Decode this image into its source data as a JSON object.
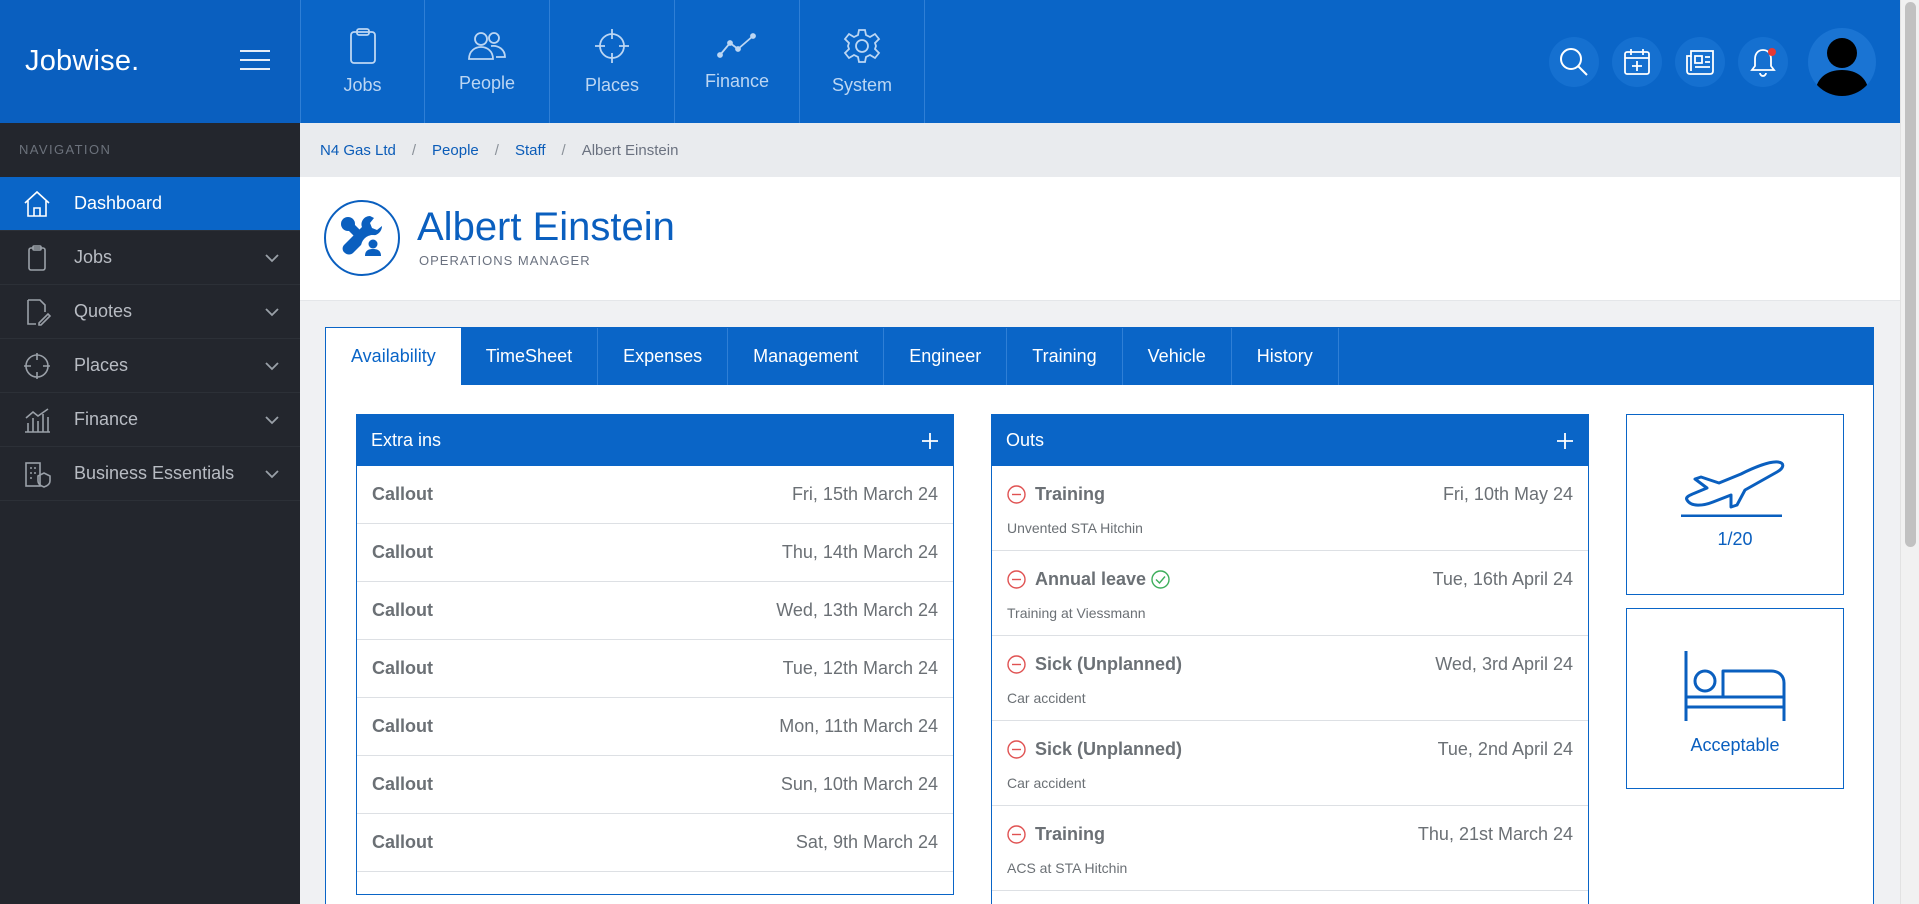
{
  "brand": {
    "name": "Jobwise."
  },
  "sidebar": {
    "heading": "NAVIGATION",
    "items": [
      {
        "label": "Dashboard",
        "icon": "home-icon",
        "active": true
      },
      {
        "label": "Jobs",
        "icon": "clipboard-icon"
      },
      {
        "label": "Quotes",
        "icon": "quote-edit-icon"
      },
      {
        "label": "Places",
        "icon": "crosshair-icon"
      },
      {
        "label": "Finance",
        "icon": "bar-chart-icon"
      },
      {
        "label": "Business Essentials",
        "icon": "building-shield-icon"
      }
    ]
  },
  "topnav": {
    "items": [
      {
        "label": "Jobs",
        "icon": "clipboard-icon"
      },
      {
        "label": "People",
        "icon": "people-icon"
      },
      {
        "label": "Places",
        "icon": "crosshair-icon"
      },
      {
        "label": "Finance",
        "icon": "line-chart-icon"
      },
      {
        "label": "System",
        "icon": "gear-icon"
      }
    ],
    "actions": [
      "search-icon",
      "calendar-plus-icon",
      "newspaper-icon",
      "bell-icon",
      "avatar"
    ]
  },
  "breadcrumb": {
    "items": [
      "N4 Gas Ltd",
      "People",
      "Staff"
    ],
    "current": "Albert Einstein"
  },
  "profile": {
    "name": "Albert Einstein",
    "role": "OPERATIONS MANAGER",
    "icon": "tools-person-icon"
  },
  "tabs": [
    "Availability",
    "TimeSheet",
    "Expenses",
    "Management",
    "Engineer",
    "Training",
    "Vehicle",
    "History"
  ],
  "extra_ins": {
    "title": "Extra ins",
    "rows": [
      {
        "type": "Callout",
        "date": "Fri, 15th March 24"
      },
      {
        "type": "Callout",
        "date": "Thu, 14th March 24"
      },
      {
        "type": "Callout",
        "date": "Wed, 13th March 24"
      },
      {
        "type": "Callout",
        "date": "Tue, 12th March 24"
      },
      {
        "type": "Callout",
        "date": "Mon, 11th March 24"
      },
      {
        "type": "Callout",
        "date": "Sun, 10th March 24"
      },
      {
        "type": "Callout",
        "date": "Sat, 9th March 24"
      }
    ]
  },
  "outs": {
    "title": "Outs",
    "rows": [
      {
        "type": "Training",
        "date": "Fri, 10th May 24",
        "note": "Unvented STA Hitchin",
        "approved": false
      },
      {
        "type": "Annual leave",
        "date": "Tue, 16th April 24",
        "note": "Training at Viessmann",
        "approved": true
      },
      {
        "type": "Sick (Unplanned)",
        "date": "Wed, 3rd April 24",
        "note": "Car accident",
        "approved": false
      },
      {
        "type": "Sick (Unplanned)",
        "date": "Tue, 2nd April 24",
        "note": "Car accident",
        "approved": false
      },
      {
        "type": "Training",
        "date": "Thu, 21st March 24",
        "note": "ACS at STA Hitchin",
        "approved": false
      }
    ]
  },
  "stats": {
    "holiday": {
      "icon": "airplane-icon",
      "value": "1/20"
    },
    "rest": {
      "icon": "bed-icon",
      "value": "Acceptable"
    }
  },
  "colors": {
    "primary": "#0a65c7",
    "sidebar": "#23262d",
    "danger": "#e05252",
    "success": "#3dae5b"
  }
}
